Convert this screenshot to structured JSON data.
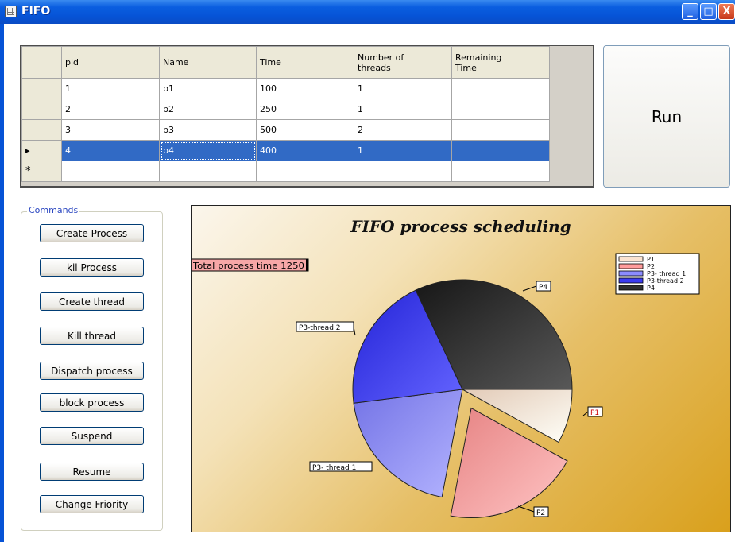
{
  "window": {
    "title": "FIFO",
    "minimize": "_",
    "maximize": "□",
    "close": "X"
  },
  "grid": {
    "columns": [
      "pid",
      "Name",
      "Time",
      "Number of threads",
      "Remaining Time"
    ],
    "header_lines": [
      [
        "pid"
      ],
      [
        "Name"
      ],
      [
        "Time"
      ],
      [
        "Number of",
        "threads"
      ],
      [
        "Remaining",
        "Time"
      ]
    ],
    "rows": [
      {
        "pid": "1",
        "name": "p1",
        "time": "100",
        "threads": "1",
        "remaining": ""
      },
      {
        "pid": "2",
        "name": "p2",
        "time": "250",
        "threads": "1",
        "remaining": ""
      },
      {
        "pid": "3",
        "name": "p3",
        "time": "500",
        "threads": "2",
        "remaining": ""
      },
      {
        "pid": "4",
        "name": "p4",
        "time": "400",
        "threads": "1",
        "remaining": ""
      }
    ],
    "selected_row": 3,
    "row_marker": "▸",
    "new_row_marker": "*"
  },
  "run_button": "Run",
  "commands": {
    "legend": "Commands",
    "buttons": [
      "Create Process",
      "kil Process",
      "Create thread",
      "Kill thread",
      "Dispatch process",
      "block process",
      "Suspend",
      "Resume",
      "Change Friority"
    ]
  },
  "chart_data": {
    "type": "pie",
    "title": "FIFO process scheduling",
    "annotation": "Total process time 1250",
    "slices": [
      {
        "name": "P1",
        "label": "P1",
        "value": 100,
        "color": "#fbe3d0",
        "exploded": false
      },
      {
        "name": "P2",
        "label": "P2",
        "value": 250,
        "color": "#ff9c9c",
        "exploded": true
      },
      {
        "name": "P3- thread 1",
        "label": "P3- thread 1",
        "value": 250,
        "color": "#8c8cff",
        "exploded": false
      },
      {
        "name": "P3-thread 2",
        "label": "P3-thread 2",
        "value": 250,
        "color": "#3c3cf0",
        "exploded": false
      },
      {
        "name": "P4",
        "label": "P4",
        "value": 400,
        "color": "#303030",
        "exploded": false
      }
    ],
    "legend": [
      "P1",
      "P2",
      "P3- thread 1",
      "P3-thread 2",
      "P4"
    ],
    "legend_placement": "top-right"
  }
}
